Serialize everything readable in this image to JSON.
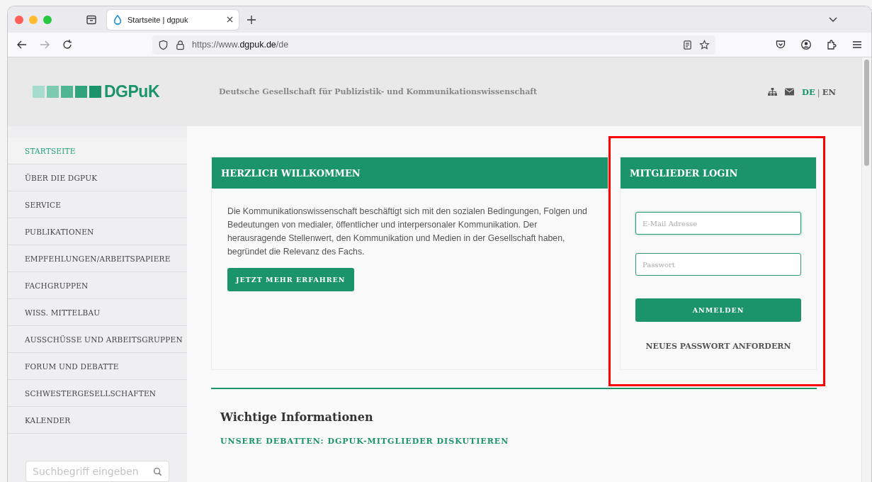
{
  "browser": {
    "tab_title": "Startseite | dgpuk",
    "url_prefix": "https://www.",
    "url_domain": "dgpuk.de",
    "url_path": "/de"
  },
  "header": {
    "logo_text": "DGPuK",
    "tagline": "Deutsche Gesellschaft für Publizistik- und Kommunikationswissenschaft",
    "languages": [
      {
        "label": "DE",
        "selected": true
      },
      {
        "label": "EN",
        "selected": false
      }
    ],
    "language_separator": "|"
  },
  "sidebar": {
    "items": [
      {
        "label": "STARTSEITE",
        "selected": true
      },
      {
        "label": "ÜBER DIE DGPUK",
        "selected": false
      },
      {
        "label": "SERVICE",
        "selected": false
      },
      {
        "label": "PUBLIKATIONEN",
        "selected": false
      },
      {
        "label": "EMPFEHLUNGEN/ARBEITSPAPIERE",
        "selected": false
      },
      {
        "label": "FACHGRUPPEN",
        "selected": false
      },
      {
        "label": "WISS. MITTELBAU",
        "selected": false
      },
      {
        "label": "AUSSCHÜSSE UND ARBEITSGRUPPEN",
        "selected": false
      },
      {
        "label": "FORUM UND DEBATTE",
        "selected": false
      },
      {
        "label": "SCHWESTERGESELLSCHAFTEN",
        "selected": false
      },
      {
        "label": "KALENDER",
        "selected": false
      }
    ],
    "search": {
      "placeholder": "Suchbegriff eingeben"
    }
  },
  "welcome": {
    "title": "HERZLICH WILLKOMMEN",
    "text": "Die Kommunikationswissenschaft beschäftigt sich mit den sozialen Bedingungen, Folgen und Bedeutungen von medialer, öffentlicher und interpersonaler Kommunikation. Der herausragende Stellenwert, den Kommunikation und Medien in der Gesellschaft haben, begründet die Relevanz des Fachs.",
    "button": "JETZT MEHR ERFAHREN"
  },
  "login": {
    "title": "MITGLIEDER LOGIN",
    "email_placeholder": "E-Mail Adresse",
    "password_placeholder": "Passwort",
    "submit": "ANMELDEN",
    "reset_link": "NEUES PASSWORT ANFORDERN"
  },
  "info": {
    "title": "Wichtige Informationen",
    "link": "UNSERE DEBATTEN: DGPUK-MITGLIEDER DISKUTIEREN"
  }
}
